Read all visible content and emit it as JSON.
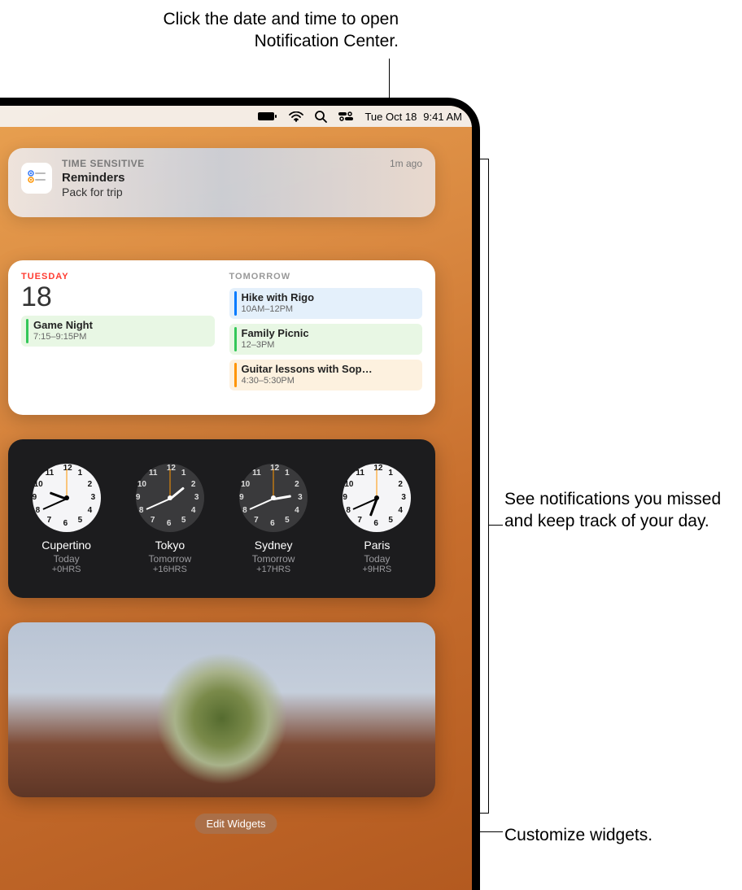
{
  "callouts": {
    "top": "Click the date and time to open Notification Center.",
    "right": "See notifications you missed and keep track of your day.",
    "bottom": "Customize widgets."
  },
  "menubar": {
    "date": "Tue Oct 18",
    "time": "9:41 AM"
  },
  "notification": {
    "tag": "TIME SENSITIVE",
    "app": "Reminders",
    "message": "Pack for trip",
    "ago": "1m ago"
  },
  "calendar": {
    "today": {
      "dayName": "TUESDAY",
      "dayNum": "18",
      "events": [
        {
          "title": "Game Night",
          "time": "7:15–9:15PM",
          "color": "green"
        }
      ]
    },
    "tomorrow": {
      "label": "TOMORROW",
      "events": [
        {
          "title": "Hike with Rigo",
          "time": "10AM–12PM",
          "color": "blue"
        },
        {
          "title": "Family Picnic",
          "time": "12–3PM",
          "color": "green"
        },
        {
          "title": "Guitar lessons with Sop…",
          "time": "4:30–5:30PM",
          "color": "orange"
        }
      ]
    }
  },
  "clocks": [
    {
      "city": "Cupertino",
      "day": "Today",
      "offset": "+0HRS",
      "face": "light",
      "hr": 9,
      "mn": 41
    },
    {
      "city": "Tokyo",
      "day": "Tomorrow",
      "offset": "+16HRS",
      "face": "dark",
      "hr": 1,
      "mn": 41
    },
    {
      "city": "Sydney",
      "day": "Tomorrow",
      "offset": "+17HRS",
      "face": "dark",
      "hr": 2,
      "mn": 41
    },
    {
      "city": "Paris",
      "day": "Today",
      "offset": "+9HRS",
      "face": "light",
      "hr": 18,
      "mn": 41
    }
  ],
  "editWidgets": "Edit Widgets"
}
